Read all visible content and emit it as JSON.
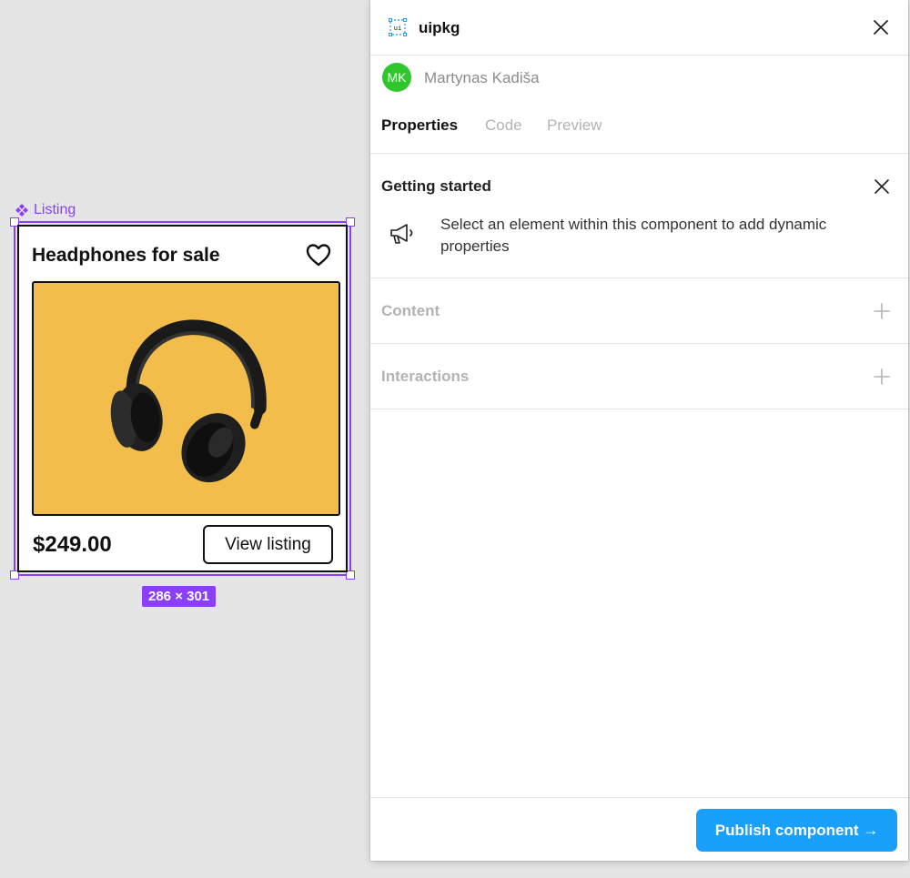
{
  "canvas": {
    "component_label": "Listing",
    "dimensions": "286 × 301",
    "card": {
      "title": "Headphones for sale",
      "price": "$249.00",
      "button_label": "View listing",
      "image_alt": "Headphones"
    }
  },
  "panel": {
    "app_name": "uipkg",
    "user": {
      "initials": "MK",
      "name": "Martynas Kadiša"
    },
    "tabs": [
      {
        "label": "Properties",
        "active": true
      },
      {
        "label": "Code",
        "active": false
      },
      {
        "label": "Preview",
        "active": false
      }
    ],
    "getting_started": {
      "title": "Getting started",
      "message": "Select an element within this component to add dynamic properties"
    },
    "sections": [
      {
        "label": "Content"
      },
      {
        "label": "Interactions"
      }
    ],
    "publish_label": "Publish component →"
  },
  "colors": {
    "selection": "#8a3ffc",
    "card_image_bg": "#f2bd4b",
    "avatar": "#2fc72c",
    "primary_button": "#18a0fb"
  }
}
